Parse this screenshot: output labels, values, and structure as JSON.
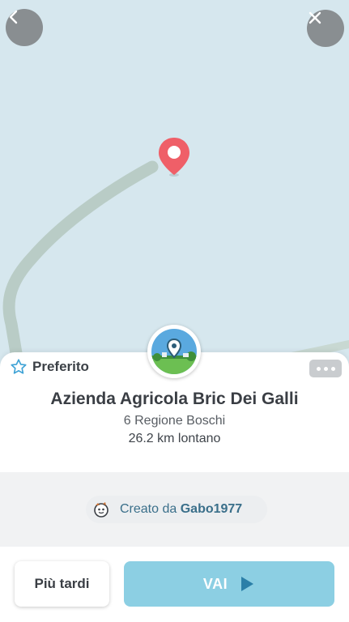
{
  "colors": {
    "map_water": "#d6e7ee",
    "road": "#b9ccc6",
    "pin": "#ef5f68",
    "accent": "#8ccfe3",
    "link": "#3a6f8a"
  },
  "map": {
    "back_icon": "chevron-left-icon",
    "close_icon": "close-icon",
    "pin_icon": "location-pin-icon"
  },
  "place": {
    "favorite_label": "Preferito",
    "favorite_icon": "star-outline-icon",
    "more_icon": "more-dots-icon",
    "name": "Azienda Agricola Bric Dei Galli",
    "address": "6 Regione Boschi",
    "distance": "26.2 km lontano"
  },
  "creator": {
    "prefix": "Creato da ",
    "username": "Gabo1977",
    "avatar_icon": "wazer-avatar-icon"
  },
  "actions": {
    "later_label": "Più tardi",
    "go_label": "VAI",
    "go_icon": "play-arrow-icon"
  }
}
